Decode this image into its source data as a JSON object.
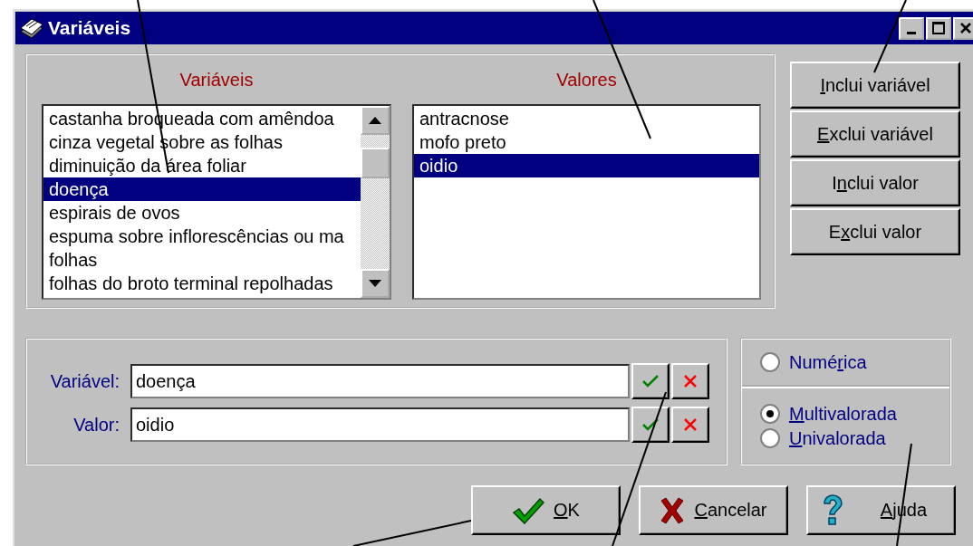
{
  "window": {
    "title": "Variáveis"
  },
  "variables_list": {
    "heading": "Variáveis",
    "items": [
      {
        "text": "castanha broqueada com amêndoa",
        "selected": false
      },
      {
        "text": "cinza vegetal sobre as folhas",
        "selected": false
      },
      {
        "text": "diminuição da área foliar",
        "selected": false
      },
      {
        "text": "doença",
        "selected": true
      },
      {
        "text": "espirais de ovos",
        "selected": false
      },
      {
        "text": "espuma sobre inflorescências ou ma",
        "selected": false
      },
      {
        "text": "folhas",
        "selected": false
      },
      {
        "text": "folhas do broto terminal repolhadas",
        "selected": false
      }
    ]
  },
  "values_list": {
    "heading": "Valores",
    "items": [
      {
        "text": "antracnose",
        "selected": false
      },
      {
        "text": "mofo preto",
        "selected": false
      },
      {
        "text": "oidio",
        "selected": true
      }
    ]
  },
  "side_buttons": [
    {
      "key": "I",
      "post": "nclui variável"
    },
    {
      "key": "E",
      "post": "xclui variável"
    },
    {
      "pre": "I",
      "key": "n",
      "post": "clui valor"
    },
    {
      "pre": "E",
      "key": "x",
      "post": "clui valor"
    }
  ],
  "editor": {
    "fields": [
      {
        "label": "Variável:",
        "value": "doença"
      },
      {
        "label": "Valor:",
        "value": "oidio"
      }
    ]
  },
  "type_groups": [
    [
      {
        "pre": "Numé",
        "key": "r",
        "post": "ica",
        "selected": false
      }
    ],
    [
      {
        "key": "M",
        "post": "ultivalorada",
        "selected": true
      },
      {
        "key": "U",
        "post": "nivalorada",
        "selected": false
      }
    ]
  ],
  "dialog_buttons": [
    {
      "kind": "ok",
      "key": "O",
      "post": "K"
    },
    {
      "kind": "cancel",
      "key": "C",
      "post": "ancelar"
    },
    {
      "kind": "help",
      "key": "A",
      "post": "juda"
    }
  ]
}
